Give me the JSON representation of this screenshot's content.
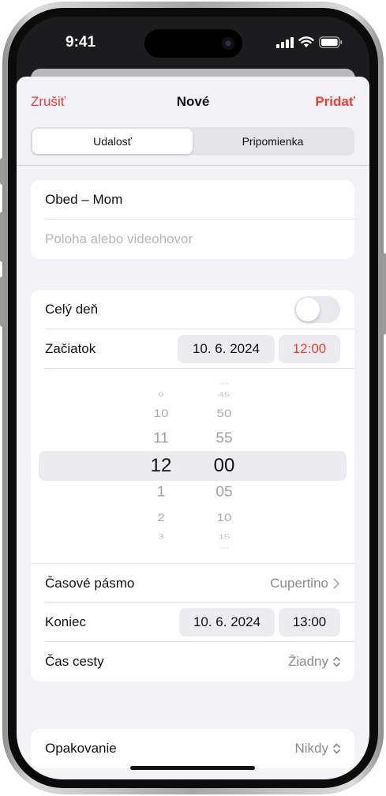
{
  "status_bar": {
    "time": "9:41",
    "icons": [
      "cellular-signal-icon",
      "wifi-icon",
      "battery-icon"
    ]
  },
  "nav": {
    "cancel": "Zrušiť",
    "title": "Nové",
    "add": "Pridať"
  },
  "segments": [
    "Udalosť",
    "Pripomienka"
  ],
  "event": {
    "title": "Obed – Mom",
    "location_placeholder": "Poloha alebo videohovor"
  },
  "details": {
    "all_day_label": "Celý deň",
    "all_day_on": false,
    "start_label": "Začiatok",
    "start_date": "10. 6. 2024",
    "start_time": "12:00",
    "picker": {
      "hours": [
        "9",
        "10",
        "11",
        "12",
        "1",
        "2",
        "3"
      ],
      "minutes": [
        "40",
        "45",
        "50",
        "55",
        "00",
        "05",
        "10",
        "15",
        "20"
      ],
      "selected_hour": "12",
      "selected_minute": "00"
    },
    "timezone_label": "Časové pásmo",
    "timezone_value": "Cupertino",
    "end_label": "Koniec",
    "end_date": "10. 6. 2024",
    "end_time": "13:00",
    "travel_label": "Čas cesty",
    "travel_value": "Žiadny"
  },
  "repeat": {
    "label": "Opakovanie",
    "value": "Nikdy"
  },
  "colors": {
    "accent": "#f23b31",
    "background": "#f2f2f7",
    "card": "#ffffff"
  }
}
